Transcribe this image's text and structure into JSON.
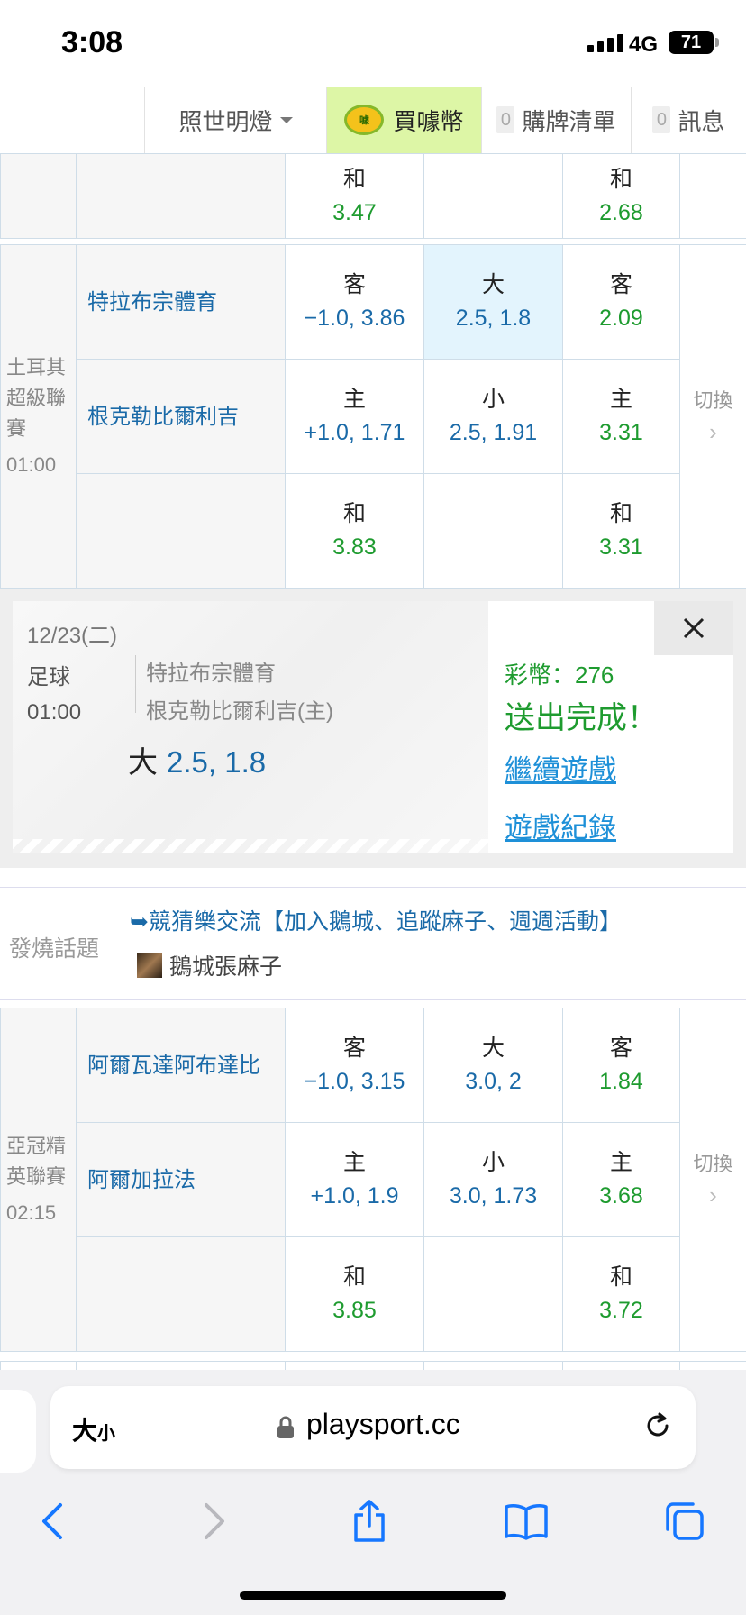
{
  "status_bar": {
    "time": "3:08",
    "network": "4G",
    "battery": "71"
  },
  "nav": {
    "lamp": "照世明燈",
    "buy_coin": "買噱幣",
    "buy_icon_text": "噱",
    "cart_count": "0",
    "cart": "購牌清單",
    "msg_count": "0",
    "msg": "訊息"
  },
  "match0": {
    "draw_label": "和",
    "col1": "3.47",
    "col3": "2.68"
  },
  "match1": {
    "league": "土耳其超級聯賽",
    "time": "01:00",
    "switch": "切換",
    "away": "特拉布宗體育",
    "home": "根克勒比爾利吉",
    "row1": {
      "c1_label": "客",
      "c1_val": "−1.0, 3.86",
      "c2_label": "大",
      "c2_val": "2.5, 1.8",
      "c3_label": "客",
      "c3_val": "2.09"
    },
    "row2": {
      "c1_label": "主",
      "c1_val": "+1.0, 1.71",
      "c2_label": "小",
      "c2_val": "2.5, 1.91",
      "c3_label": "主",
      "c3_val": "3.31"
    },
    "row3": {
      "c1_label": "和",
      "c1_val": "3.83",
      "c3_label": "和",
      "c3_val": "3.31"
    }
  },
  "receipt": {
    "date": "12/23(二)",
    "sport": "足球",
    "time": "01:00",
    "team1": "特拉布宗體育",
    "team2": "根克勒比爾利吉(主)",
    "pick_label": "大",
    "pick_val": "2.5, 1.8",
    "coin": "彩幣：276",
    "done": "送出完成！",
    "continue": "繼續遊戲",
    "history": "遊戲紀錄"
  },
  "hot": {
    "label": "發燒話題",
    "title": "➥競猜樂交流【加入鵝城、追蹤麻子、週週活動】",
    "author": "鵝城張麻子"
  },
  "match2": {
    "league": "亞冠精英聯賽",
    "time": "02:15",
    "switch": "切換",
    "away": "阿爾瓦達阿布達比",
    "home": "阿爾加拉法",
    "row1": {
      "c1_label": "客",
      "c1_val": "−1.0, 3.15",
      "c2_label": "大",
      "c2_val": "3.0, 2",
      "c3_label": "客",
      "c3_val": "1.84"
    },
    "row2": {
      "c1_label": "主",
      "c1_val": "+1.0, 1.9",
      "c2_label": "小",
      "c2_val": "3.0, 1.73",
      "c3_label": "主",
      "c3_val": "3.68"
    },
    "row3": {
      "c1_label": "和",
      "c1_val": "3.85",
      "c3_label": "和",
      "c3_val": "3.72"
    }
  },
  "browser": {
    "aa_big": "大",
    "aa_small": "小",
    "url": "playsport.cc"
  }
}
